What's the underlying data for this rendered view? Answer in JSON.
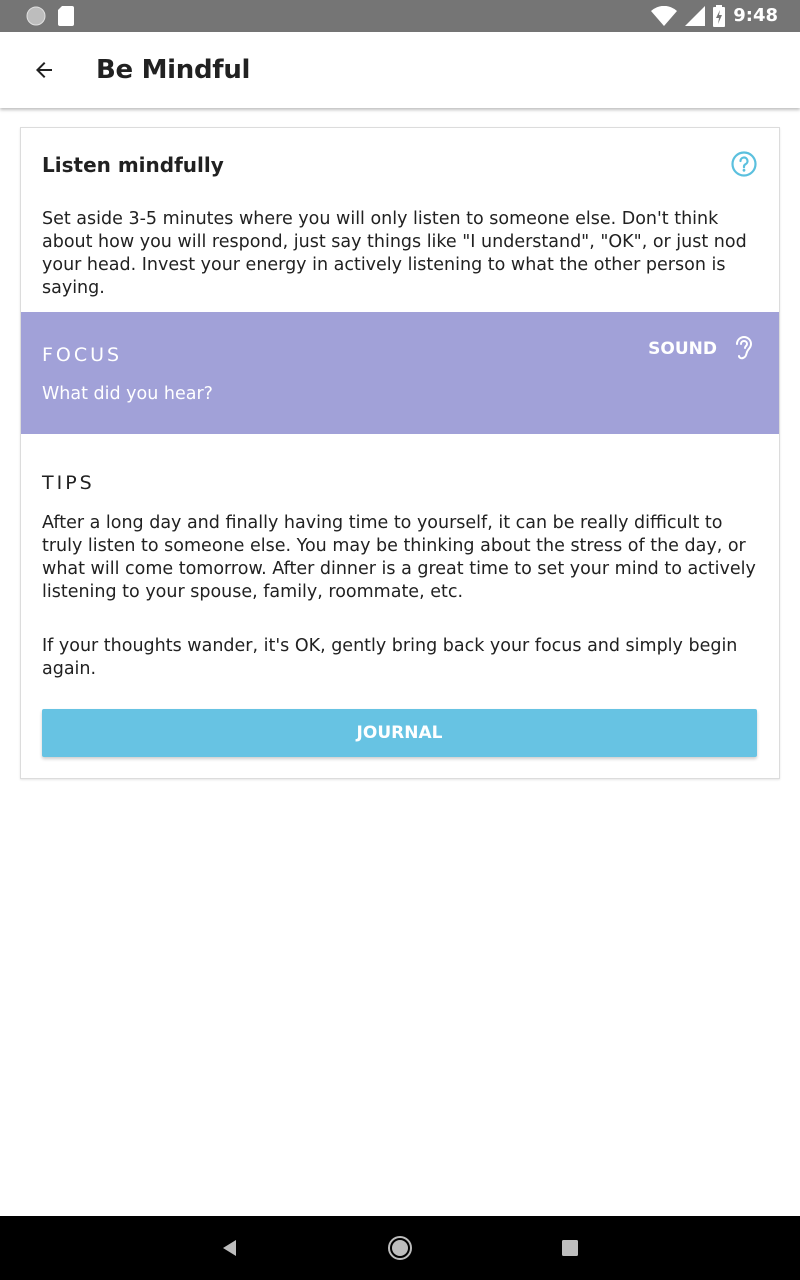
{
  "status_bar": {
    "time": "9:48",
    "icons": [
      "notification-dot-icon",
      "sd-card-icon",
      "wifi-icon",
      "cell-signal-icon",
      "battery-charging-icon"
    ]
  },
  "app_bar": {
    "title": "Be Mindful",
    "back_icon": "arrow-back-icon"
  },
  "card": {
    "title": "Listen mindfully",
    "help_icon": "help-circle-icon",
    "description": "Set aside 3-5 minutes where you will only listen to someone else. Don't think about how you will respond, just say things like \"I understand\", \"OK\", or just nod your head. Invest your energy in actively listening to what the other person is saying.",
    "focus": {
      "label": "FOCUS",
      "question": "What did you hear?",
      "sense_label": "SOUND",
      "sense_icon": "ear-icon",
      "background_color": "#a1a1d8"
    },
    "tips": {
      "label": "TIPS",
      "paragraphs": [
        "After a long day and finally having time to yourself, it can be really difficult to truly listen to someone else. You may be thinking about the stress of the day, or what will come tomorrow. After dinner is a great time to set your mind to actively listening to your spouse, family, roommate, etc.",
        "If your thoughts wander, it's OK, gently bring back your focus and simply begin again."
      ]
    },
    "journal_button": {
      "label": "JOURNAL",
      "color": "#67c3e3"
    }
  },
  "nav_bar": {
    "buttons": [
      "nav-back-icon",
      "nav-home-icon",
      "nav-recents-icon"
    ]
  },
  "colors": {
    "accent": "#67c3e3",
    "focus_bg": "#a1a1d8",
    "status_bar": "#757575"
  }
}
